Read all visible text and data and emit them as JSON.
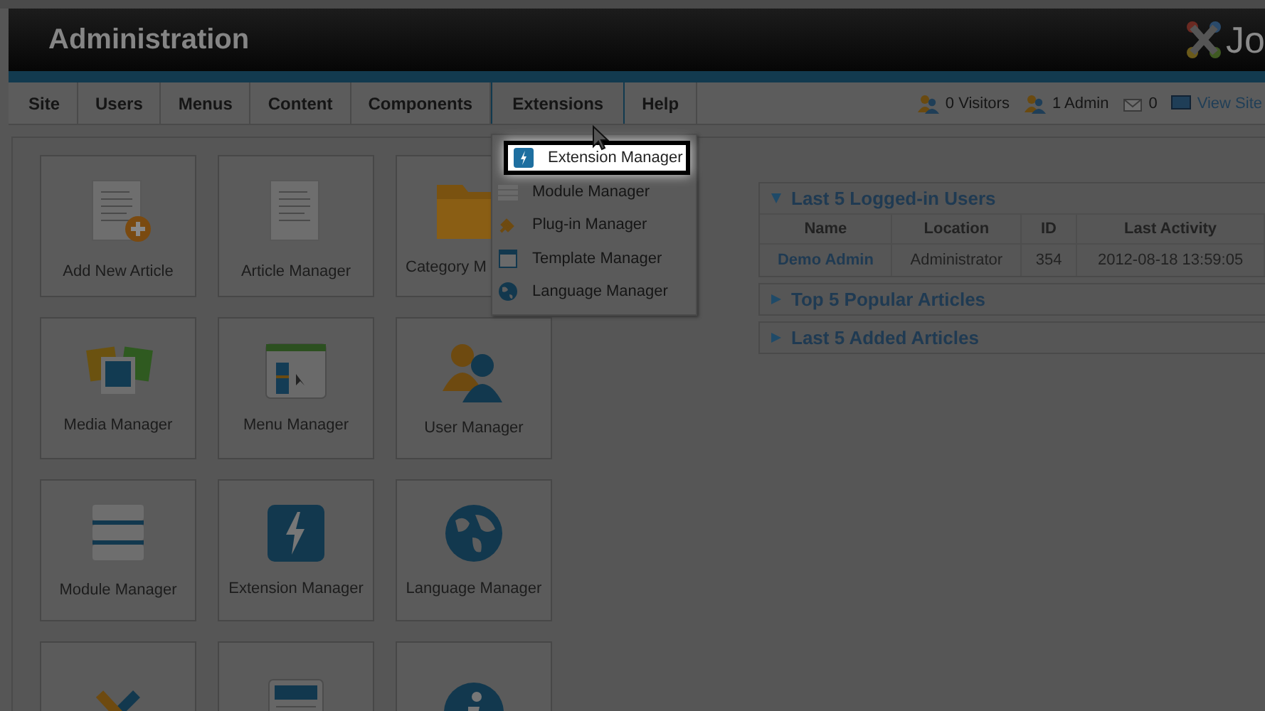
{
  "header": {
    "title": "Administration",
    "logo_text": "Jo"
  },
  "menu": [
    {
      "label": "Site",
      "selected": false
    },
    {
      "label": "Users",
      "selected": false
    },
    {
      "label": "Menus",
      "selected": false
    },
    {
      "label": "Content",
      "selected": false
    },
    {
      "label": "Components",
      "selected": false
    },
    {
      "label": "Extensions",
      "selected": true
    },
    {
      "label": "Help",
      "selected": false
    }
  ],
  "status": [
    {
      "kind": "visitors",
      "label": "0 Visitors"
    },
    {
      "kind": "admins",
      "label": "1 Admin"
    },
    {
      "kind": "messages",
      "label": "0"
    },
    {
      "kind": "site",
      "label": "View Site"
    }
  ],
  "dropdown": [
    {
      "kind": "extension",
      "label": "Extension Manager",
      "selected": true
    },
    {
      "kind": "module",
      "label": "Module Manager",
      "selected": false
    },
    {
      "kind": "plugin",
      "label": "Plug-in Manager",
      "selected": false
    },
    {
      "kind": "template",
      "label": "Template Manager",
      "selected": false
    },
    {
      "kind": "language",
      "label": "Language Manager",
      "selected": false
    }
  ],
  "tiles": [
    {
      "kind": "add-article",
      "label": "Add New Article"
    },
    {
      "kind": "article",
      "label": "Article Manager"
    },
    {
      "kind": "category",
      "label": "Category M",
      "cut_by_menu": true
    },
    {
      "kind": "media",
      "label": "Media Manager"
    },
    {
      "kind": "menu",
      "label": "Menu Manager"
    },
    {
      "kind": "user",
      "label": "User Manager"
    },
    {
      "kind": "module",
      "label": "Module Manager"
    },
    {
      "kind": "extension",
      "label": "Extension Manager"
    },
    {
      "kind": "language",
      "label": "Language Manager"
    },
    {
      "kind": "tools"
    },
    {
      "kind": "template"
    },
    {
      "kind": "info"
    }
  ],
  "panels": [
    {
      "title": "Last 5 Logged-in Users",
      "expanded": true,
      "columns": [
        "Name",
        "Location",
        "ID",
        "Last Activity"
      ],
      "rows": [
        [
          "Demo Admin",
          "Administrator",
          "354",
          "2012-08-18 13:59:05"
        ]
      ]
    },
    {
      "title": "Top 5 Popular Articles",
      "expanded": false
    },
    {
      "title": "Last 5 Added Articles",
      "expanded": false
    }
  ]
}
